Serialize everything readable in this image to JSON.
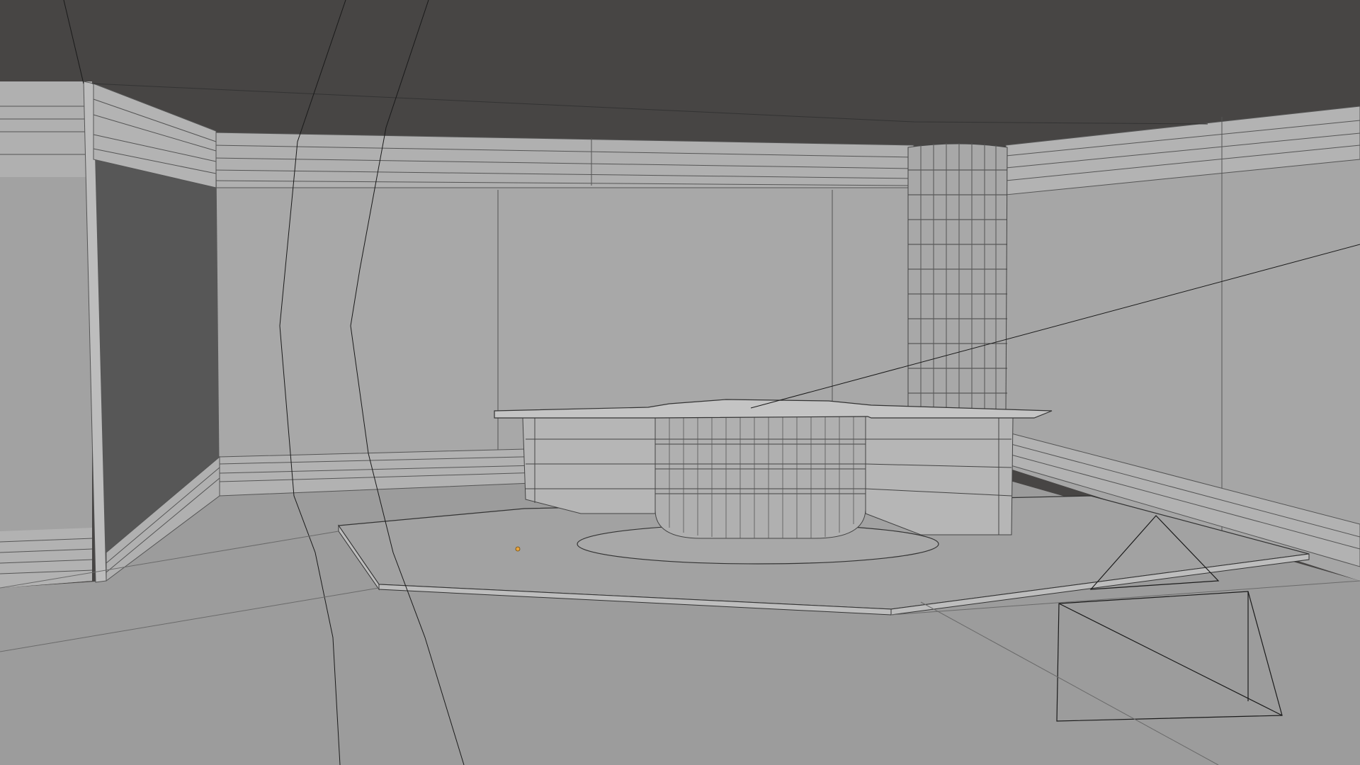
{
  "app": {
    "kind": "3D viewport",
    "shading_mode": "solid",
    "overlays": "wireframe"
  },
  "scene": {
    "objects": [
      {
        "name": "ceiling",
        "type": "mesh"
      },
      {
        "name": "back-wall",
        "type": "mesh"
      },
      {
        "name": "left-wall",
        "type": "mesh"
      },
      {
        "name": "right-wall",
        "type": "mesh"
      },
      {
        "name": "left-doorway",
        "type": "mesh"
      },
      {
        "name": "floor",
        "type": "mesh"
      },
      {
        "name": "stage-platform",
        "type": "mesh"
      },
      {
        "name": "news-desk",
        "type": "mesh"
      },
      {
        "name": "cylindrical-pillar",
        "type": "mesh"
      },
      {
        "name": "camera",
        "type": "camera"
      },
      {
        "name": "origin-point",
        "type": "empty"
      }
    ]
  },
  "colors": {
    "ceiling": "#474544",
    "wall": "#a4a4a4",
    "wall_light": "#b2b2b2",
    "floor": "#9c9c9c",
    "doorway": "#555555",
    "edge": "#3a3a3a",
    "wire": "#1a1a1a",
    "origin": "#e8a33c"
  }
}
